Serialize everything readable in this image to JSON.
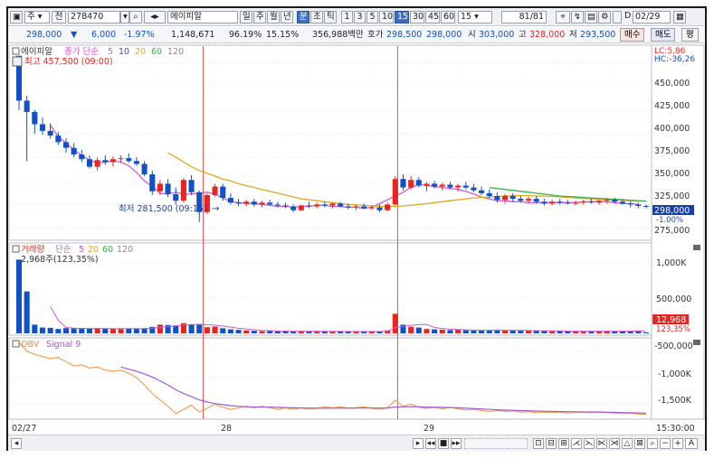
{
  "toolbar": {
    "type_select": "주",
    "market_label": "전",
    "code": "278470",
    "stock_name": "에이피알",
    "period_buttons": [
      "일",
      "주",
      "월",
      "년",
      "분",
      "초",
      "틱"
    ],
    "interval_buttons": [
      "1",
      "3",
      "5",
      "10",
      "15",
      "30",
      "45",
      "60"
    ],
    "interval_value": "15",
    "page_label": "81",
    "page_total": "/81",
    "date_value": "02/29",
    "date_check": "D"
  },
  "quote": {
    "price": "298,000",
    "change": "6,000",
    "change_pct": "-1.97%",
    "volume": "1,148,671",
    "vol_ratio": "96.19%",
    "turnover": "15.15%",
    "amount": "356,988백만",
    "ask_label": "호가",
    "ask_value": "298,500",
    "bid_value": "298,000",
    "open_label": "시",
    "open_value": "303,000",
    "high_label": "고",
    "high_value": "328,000",
    "low_label": "저",
    "low_value": "293,500",
    "buy_button": "매수",
    "sell_button": "매도",
    "eval_button": "평"
  },
  "price_panel": {
    "legend_name": "에이피알",
    "legend_ma": "종가 단순",
    "ma_periods": [
      "5",
      "10",
      "20",
      "60",
      "120"
    ],
    "high_marker": "최고 457,500 (09:00)",
    "low_marker": "최저 281,500 (09:15)",
    "lc_label": "LC:5,86",
    "hc_label": "HC:-36,26",
    "current_price_tag": "298,000",
    "current_pct_tag": "-1.00%",
    "y_ticks": [
      "450,000",
      "425,000",
      "400,000",
      "375,000",
      "350,000",
      "325,000",
      "275,000"
    ]
  },
  "volume_panel": {
    "legend_name": "거래량",
    "legend_ma": "단순",
    "ma_periods": [
      "5",
      "20",
      "60",
      "120"
    ],
    "vol_note": "2,968주(123,35%)",
    "y_ticks": [
      "1,000K",
      "500,000"
    ],
    "current_tag": "12,968",
    "current_pct": "123,35%"
  },
  "obv_panel": {
    "legend_name": "OBV",
    "legend_signal": "Signal 9",
    "y_ticks": [
      "-500,000",
      "-1,000K",
      "-1,500K"
    ]
  },
  "x_axis": {
    "labels": [
      "02/27",
      "28",
      "29"
    ],
    "time_label": "15:30:00"
  },
  "colors": {
    "up": "#e8261f",
    "down": "#1050c8",
    "ma5": "#d05cd0",
    "ma10": "#3a4cc8",
    "ma20": "#e0a81e",
    "ma60": "#3bae4a",
    "obv": "#f5a05a",
    "signal": "#a25ad0",
    "vline": "#e65050"
  },
  "chart_data": {
    "type": "candlestick",
    "interval_minutes": 15,
    "y_range": [
      265000,
      462000
    ],
    "candles": [
      {
        "o": 457500,
        "h": 457500,
        "l": 400000,
        "c": 410000
      },
      {
        "o": 410000,
        "h": 415000,
        "l": 346000,
        "c": 398000
      },
      {
        "o": 398000,
        "h": 400000,
        "l": 375000,
        "c": 385000
      },
      {
        "o": 385000,
        "h": 392000,
        "l": 374000,
        "c": 378000
      },
      {
        "o": 378000,
        "h": 386000,
        "l": 370000,
        "c": 373000
      },
      {
        "o": 373000,
        "h": 377000,
        "l": 363000,
        "c": 366000
      },
      {
        "o": 366000,
        "h": 370000,
        "l": 355000,
        "c": 360000
      },
      {
        "o": 360000,
        "h": 365000,
        "l": 350000,
        "c": 353000
      },
      {
        "o": 353000,
        "h": 358000,
        "l": 345000,
        "c": 348000
      },
      {
        "o": 348000,
        "h": 352000,
        "l": 338000,
        "c": 340000
      },
      {
        "o": 340000,
        "h": 350000,
        "l": 336000,
        "c": 347000
      },
      {
        "o": 347000,
        "h": 352000,
        "l": 342000,
        "c": 345000
      },
      {
        "o": 345000,
        "h": 351000,
        "l": 340000,
        "c": 348000
      },
      {
        "o": 348000,
        "h": 352000,
        "l": 344000,
        "c": 349000
      },
      {
        "o": 349000,
        "h": 354000,
        "l": 344000,
        "c": 346000
      },
      {
        "o": 346000,
        "h": 350000,
        "l": 341000,
        "c": 343000
      },
      {
        "o": 343000,
        "h": 346000,
        "l": 330000,
        "c": 332000
      },
      {
        "o": 332000,
        "h": 336000,
        "l": 310000,
        "c": 314000
      },
      {
        "o": 314000,
        "h": 326000,
        "l": 310000,
        "c": 322000
      },
      {
        "o": 322000,
        "h": 327000,
        "l": 308000,
        "c": 311000
      },
      {
        "o": 311000,
        "h": 318000,
        "l": 300000,
        "c": 304000
      },
      {
        "o": 304000,
        "h": 328000,
        "l": 302000,
        "c": 326000
      },
      {
        "o": 326000,
        "h": 331000,
        "l": 310000,
        "c": 313000
      },
      {
        "o": 313000,
        "h": 315000,
        "l": 281500,
        "c": 292000
      },
      {
        "o": 292000,
        "h": 312000,
        "l": 290000,
        "c": 310000
      },
      {
        "o": 310000,
        "h": 322000,
        "l": 308000,
        "c": 319000
      },
      {
        "o": 319000,
        "h": 322000,
        "l": 304000,
        "c": 307000
      },
      {
        "o": 307000,
        "h": 312000,
        "l": 300000,
        "c": 302000
      },
      {
        "o": 302000,
        "h": 306000,
        "l": 298000,
        "c": 301000
      },
      {
        "o": 301000,
        "h": 305000,
        "l": 298000,
        "c": 303000
      },
      {
        "o": 303000,
        "h": 306000,
        "l": 298000,
        "c": 300000
      },
      {
        "o": 300000,
        "h": 304000,
        "l": 297000,
        "c": 302000
      },
      {
        "o": 302000,
        "h": 305000,
        "l": 299000,
        "c": 300000
      },
      {
        "o": 300000,
        "h": 303000,
        "l": 297000,
        "c": 299000
      },
      {
        "o": 299000,
        "h": 302000,
        "l": 296000,
        "c": 298000
      },
      {
        "o": 298000,
        "h": 300000,
        "l": 292000,
        "c": 294000
      },
      {
        "o": 294000,
        "h": 300000,
        "l": 293000,
        "c": 299000
      },
      {
        "o": 299000,
        "h": 303000,
        "l": 296000,
        "c": 298000
      },
      {
        "o": 298000,
        "h": 302000,
        "l": 296000,
        "c": 300000
      },
      {
        "o": 300000,
        "h": 303000,
        "l": 297000,
        "c": 299000
      },
      {
        "o": 299000,
        "h": 302000,
        "l": 296000,
        "c": 301000
      },
      {
        "o": 301000,
        "h": 303000,
        "l": 297000,
        "c": 298000
      },
      {
        "o": 298000,
        "h": 301000,
        "l": 295000,
        "c": 297000
      },
      {
        "o": 297000,
        "h": 300000,
        "l": 294000,
        "c": 298000
      },
      {
        "o": 298000,
        "h": 301000,
        "l": 295000,
        "c": 296000
      },
      {
        "o": 296000,
        "h": 299000,
        "l": 294000,
        "c": 297000
      },
      {
        "o": 297000,
        "h": 300000,
        "l": 292000,
        "c": 294000
      },
      {
        "o": 294000,
        "h": 302000,
        "l": 293000,
        "c": 300000
      },
      {
        "o": 300000,
        "h": 330000,
        "l": 299000,
        "c": 327000
      },
      {
        "o": 327000,
        "h": 332000,
        "l": 315000,
        "c": 318000
      },
      {
        "o": 318000,
        "h": 330000,
        "l": 316000,
        "c": 326000
      },
      {
        "o": 326000,
        "h": 329000,
        "l": 318000,
        "c": 320000
      },
      {
        "o": 320000,
        "h": 324000,
        "l": 314000,
        "c": 322000
      },
      {
        "o": 322000,
        "h": 325000,
        "l": 317000,
        "c": 319000
      },
      {
        "o": 319000,
        "h": 323000,
        "l": 315000,
        "c": 321000
      },
      {
        "o": 321000,
        "h": 324000,
        "l": 316000,
        "c": 318000
      },
      {
        "o": 318000,
        "h": 322000,
        "l": 314000,
        "c": 320000
      },
      {
        "o": 320000,
        "h": 324000,
        "l": 316000,
        "c": 318000
      },
      {
        "o": 318000,
        "h": 322000,
        "l": 313000,
        "c": 315000
      },
      {
        "o": 315000,
        "h": 319000,
        "l": 310000,
        "c": 312000
      },
      {
        "o": 312000,
        "h": 316000,
        "l": 307000,
        "c": 309000
      },
      {
        "o": 309000,
        "h": 313000,
        "l": 302000,
        "c": 305000
      },
      {
        "o": 305000,
        "h": 311000,
        "l": 301000,
        "c": 309000
      },
      {
        "o": 309000,
        "h": 312000,
        "l": 303000,
        "c": 306000
      },
      {
        "o": 306000,
        "h": 309000,
        "l": 302000,
        "c": 304000
      },
      {
        "o": 304000,
        "h": 308000,
        "l": 301000,
        "c": 306000
      },
      {
        "o": 306000,
        "h": 309000,
        "l": 301000,
        "c": 303000
      },
      {
        "o": 303000,
        "h": 306000,
        "l": 299000,
        "c": 301000
      },
      {
        "o": 301000,
        "h": 305000,
        "l": 299000,
        "c": 303000
      },
      {
        "o": 303000,
        "h": 306000,
        "l": 300000,
        "c": 302000
      },
      {
        "o": 302000,
        "h": 305000,
        "l": 300000,
        "c": 301000
      },
      {
        "o": 301000,
        "h": 304000,
        "l": 299000,
        "c": 302000
      },
      {
        "o": 302000,
        "h": 305000,
        "l": 300000,
        "c": 303000
      },
      {
        "o": 303000,
        "h": 306000,
        "l": 301000,
        "c": 302000
      },
      {
        "o": 302000,
        "h": 305000,
        "l": 300000,
        "c": 304000
      },
      {
        "o": 304000,
        "h": 307000,
        "l": 301000,
        "c": 305000
      },
      {
        "o": 305000,
        "h": 307000,
        "l": 301000,
        "c": 303000
      },
      {
        "o": 303000,
        "h": 306000,
        "l": 300000,
        "c": 301000
      },
      {
        "o": 301000,
        "h": 303000,
        "l": 297000,
        "c": 300000
      },
      {
        "o": 300000,
        "h": 302000,
        "l": 296000,
        "c": 298500
      },
      {
        "o": 298500,
        "h": 300000,
        "l": 296000,
        "c": 298000
      }
    ],
    "volume_range": [
      0,
      1200000
    ],
    "volume": [
      1020000,
      580000,
      120000,
      80000,
      75000,
      60000,
      72000,
      70000,
      68000,
      66000,
      70000,
      65000,
      62000,
      60000,
      70000,
      65000,
      72000,
      90000,
      120000,
      115000,
      110000,
      140000,
      120000,
      130000,
      85000,
      95000,
      70000,
      55000,
      48000,
      40000,
      35000,
      30000,
      32000,
      28000,
      30000,
      26000,
      34000,
      30000,
      28000,
      26000,
      24000,
      30000,
      26000,
      28000,
      24000,
      26000,
      30000,
      42000,
      270000,
      120000,
      90000,
      80000,
      60000,
      55000,
      50000,
      45000,
      50000,
      42000,
      40000,
      38000,
      44000,
      52000,
      40000,
      38000,
      36000,
      40000,
      34000,
      32000,
      30000,
      33000,
      30000,
      28000,
      31000,
      30000,
      28000,
      30000,
      32000,
      28000,
      30000,
      40000,
      12968
    ],
    "obv_range": [
      -1750000,
      -300000
    ],
    "obv": [
      -340000,
      -500000,
      -560000,
      -600000,
      -640000,
      -620000,
      -700000,
      -780000,
      -760000,
      -820000,
      -800000,
      -860000,
      -880000,
      -860000,
      -920000,
      -1000000,
      -1140000,
      -1300000,
      -1420000,
      -1540000,
      -1680000,
      -1600000,
      -1520000,
      -1650000,
      -1580000,
      -1500000,
      -1560000,
      -1600000,
      -1570000,
      -1540000,
      -1570000,
      -1540000,
      -1570000,
      -1600000,
      -1570000,
      -1600000,
      -1570000,
      -1600000,
      -1580000,
      -1550000,
      -1570000,
      -1550000,
      -1580000,
      -1570000,
      -1550000,
      -1580000,
      -1600000,
      -1570000,
      -1430000,
      -1540000,
      -1500000,
      -1560000,
      -1580000,
      -1560000,
      -1590000,
      -1560000,
      -1590000,
      -1610000,
      -1600000,
      -1620000,
      -1640000,
      -1620000,
      -1640000,
      -1630000,
      -1650000,
      -1640000,
      -1660000,
      -1650000,
      -1660000,
      -1650000,
      -1670000,
      -1660000,
      -1650000,
      -1660000,
      -1640000,
      -1660000,
      -1670000,
      -1680000,
      -1670000,
      -1690000,
      -1690000
    ],
    "signal": [
      null,
      null,
      null,
      null,
      null,
      null,
      null,
      null,
      null,
      null,
      null,
      null,
      null,
      -800000,
      -840000,
      -880000,
      -930000,
      -990000,
      -1060000,
      -1140000,
      -1230000,
      -1300000,
      -1360000,
      -1420000,
      -1460000,
      -1490000,
      -1510000,
      -1530000,
      -1540000,
      -1550000,
      -1555000,
      -1555000,
      -1557000,
      -1560000,
      -1565000,
      -1570000,
      -1572000,
      -1575000,
      -1576000,
      -1577000,
      -1576000,
      -1575000,
      -1576000,
      -1574000,
      -1572000,
      -1574000,
      -1575000,
      -1573000,
      -1555000,
      -1550000,
      -1548000,
      -1550000,
      -1555000,
      -1557000,
      -1560000,
      -1565000,
      -1570000,
      -1578000,
      -1585000,
      -1592000,
      -1600000,
      -1606000,
      -1612000,
      -1617000,
      -1622000,
      -1626000,
      -1630000,
      -1634000,
      -1637000,
      -1640000,
      -1643000,
      -1645000,
      -1647000,
      -1650000,
      -1652000,
      -1654000,
      -1657000,
      -1660000,
      -1663000,
      -1666000,
      -1670000
    ],
    "ma_lines": [
      {
        "period": 5,
        "start": 4,
        "values": [
          384000,
          372000,
          365000,
          358000,
          352000,
          347000,
          344000,
          345000,
          346000,
          345000,
          341000,
          334000,
          325000,
          319000,
          312000,
          311000,
          313000,
          311000,
          311000,
          312000,
          313000,
          311000,
          307000,
          303000,
          302000,
          301000,
          301000,
          300000,
          299000,
          298000,
          298000,
          297000,
          298000,
          298000,
          299000,
          299000,
          298000,
          298000,
          297000,
          297000,
          296000,
          297000,
          301000,
          305000,
          309000,
          313000,
          318000,
          321000,
          320000,
          319000,
          318000,
          317000,
          316000,
          314000,
          311000,
          308000,
          306000,
          304000,
          304000,
          303000,
          303000,
          302000,
          302000,
          302000,
          302000,
          302000,
          302000,
          302000,
          303000,
          303000,
          303000,
          303000,
          302000,
          301000,
          301000,
          300000
        ]
      },
      {
        "period": 20,
        "start": 19,
        "values": [
          355000,
          350000,
          345000,
          340000,
          336000,
          333000,
          330000,
          327000,
          325000,
          322000,
          320000,
          318000,
          316000,
          314000,
          312000,
          310000,
          308000,
          306000,
          305000,
          304000,
          303000,
          302000,
          301000,
          300000,
          299500,
          299000,
          298500,
          298000,
          298000,
          298000,
          298500,
          299000,
          300000,
          301000,
          302000,
          303000,
          304000,
          305000,
          306000,
          307000,
          307500,
          308000,
          308500,
          309000,
          309500,
          309500,
          309500,
          309000,
          309000,
          308500,
          308000,
          307500,
          307000,
          306500,
          306000,
          305500,
          305000,
          305000,
          304500,
          304000,
          304000,
          303500
        ]
      },
      {
        "period": 60,
        "start": 60,
        "values": [
          318000,
          317000,
          316000,
          315000,
          314000,
          313000,
          312000,
          311000,
          310000,
          309000,
          308500,
          308000,
          307500,
          307000,
          306500,
          306000,
          305500,
          305000,
          304500,
          304000,
          303500
        ]
      }
    ]
  }
}
